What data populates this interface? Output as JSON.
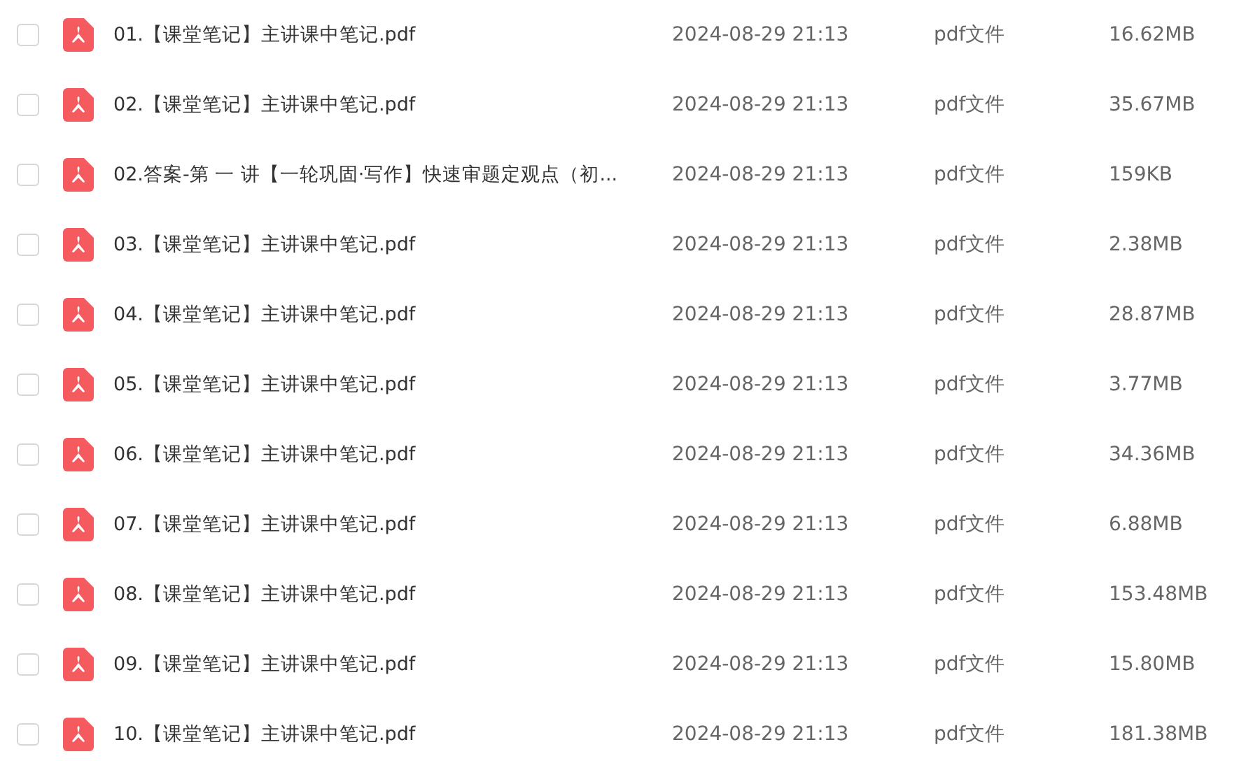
{
  "files": [
    {
      "name": "01.【课堂笔记】主讲课中笔记.pdf",
      "date": "2024-08-29 21:13",
      "type": "pdf文件",
      "size": "16.62MB",
      "checked": false
    },
    {
      "name": "02.【课堂笔记】主讲课中笔记.pdf",
      "date": "2024-08-29 21:13",
      "type": "pdf文件",
      "size": "35.67MB",
      "checked": false
    },
    {
      "name": "02.答案-第 一 讲【一轮巩固·写作】快速审题定观点（初...",
      "date": "2024-08-29 21:13",
      "type": "pdf文件",
      "size": "159KB",
      "checked": false
    },
    {
      "name": "03.【课堂笔记】主讲课中笔记.pdf",
      "date": "2024-08-29 21:13",
      "type": "pdf文件",
      "size": "2.38MB",
      "checked": false
    },
    {
      "name": "04.【课堂笔记】主讲课中笔记.pdf",
      "date": "2024-08-29 21:13",
      "type": "pdf文件",
      "size": "28.87MB",
      "checked": false
    },
    {
      "name": "05.【课堂笔记】主讲课中笔记.pdf",
      "date": "2024-08-29 21:13",
      "type": "pdf文件",
      "size": "3.77MB",
      "checked": false
    },
    {
      "name": "06.【课堂笔记】主讲课中笔记.pdf",
      "date": "2024-08-29 21:13",
      "type": "pdf文件",
      "size": "34.36MB",
      "checked": false
    },
    {
      "name": "07.【课堂笔记】主讲课中笔记.pdf",
      "date": "2024-08-29 21:13",
      "type": "pdf文件",
      "size": "6.88MB",
      "checked": false
    },
    {
      "name": "08.【课堂笔记】主讲课中笔记.pdf",
      "date": "2024-08-29 21:13",
      "type": "pdf文件",
      "size": "153.48MB",
      "checked": false
    },
    {
      "name": "09.【课堂笔记】主讲课中笔记.pdf",
      "date": "2024-08-29 21:13",
      "type": "pdf文件",
      "size": "15.80MB",
      "checked": false
    },
    {
      "name": "10.【课堂笔记】主讲课中笔记.pdf",
      "date": "2024-08-29 21:13",
      "type": "pdf文件",
      "size": "181.38MB",
      "checked": false
    }
  ]
}
